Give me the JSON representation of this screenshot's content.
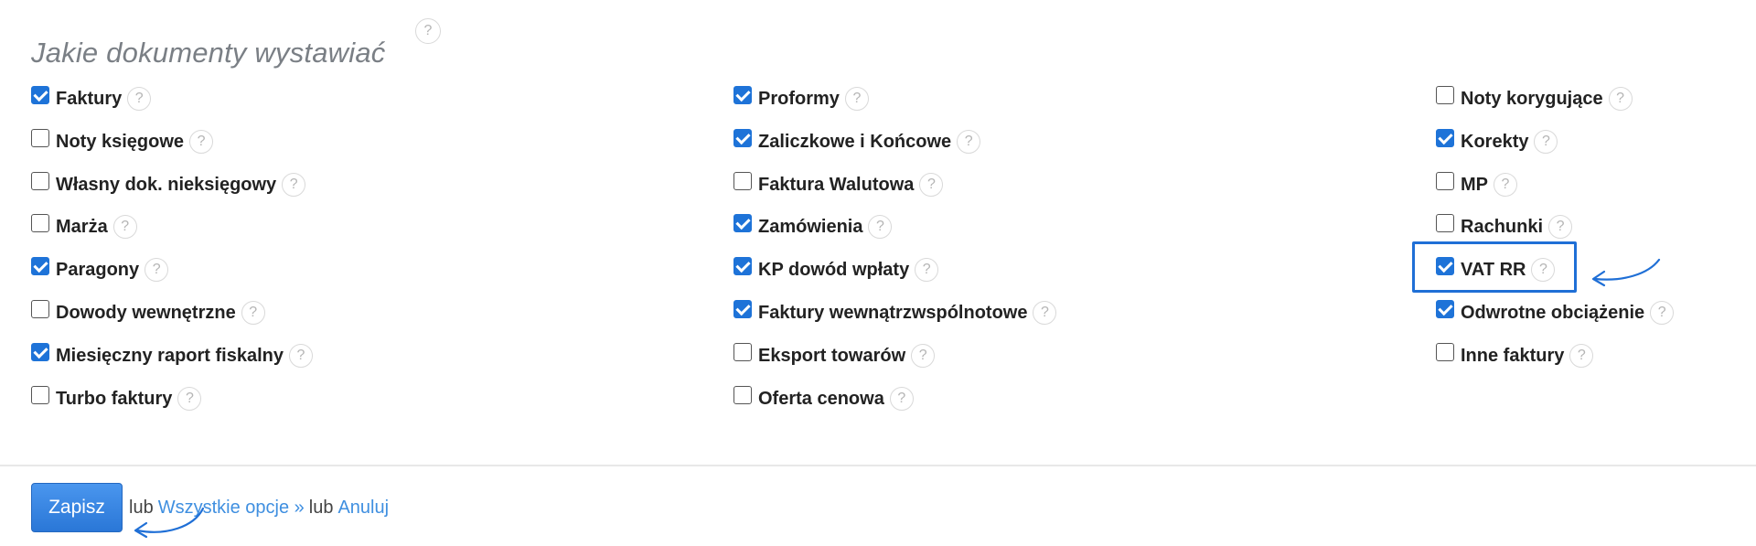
{
  "header": {
    "title": "Jakie dokumenty wystawiać",
    "help_glyph": "?"
  },
  "columns": [
    {
      "items": [
        {
          "label": "Faktury",
          "checked": true
        },
        {
          "label": "Noty księgowe",
          "checked": false
        },
        {
          "label": "Własny dok. nieksięgowy",
          "checked": false
        },
        {
          "label": "Marża",
          "checked": false
        },
        {
          "label": "Paragony",
          "checked": true
        },
        {
          "label": "Dowody wewnętrzne",
          "checked": false
        },
        {
          "label": "Miesięczny raport fiskalny",
          "checked": true
        },
        {
          "label": "Turbo faktury",
          "checked": false
        }
      ]
    },
    {
      "items": [
        {
          "label": "Proformy",
          "checked": true
        },
        {
          "label": "Zaliczkowe i Końcowe",
          "checked": true
        },
        {
          "label": "Faktura Walutowa",
          "checked": false
        },
        {
          "label": "Zamówienia",
          "checked": true
        },
        {
          "label": "KP dowód wpłaty",
          "checked": true
        },
        {
          "label": "Faktury wewnątrzwspólnotowe",
          "checked": true
        },
        {
          "label": "Eksport towarów",
          "checked": false
        },
        {
          "label": "Oferta cenowa",
          "checked": false
        }
      ]
    },
    {
      "items": [
        {
          "label": "Noty korygujące",
          "checked": false
        },
        {
          "label": "Korekty",
          "checked": true
        },
        {
          "label": "MP",
          "checked": false
        },
        {
          "label": "Rachunki",
          "checked": false
        },
        {
          "label": "VAT RR",
          "checked": true,
          "highlighted": true
        },
        {
          "label": "Odwrotne obciążenie",
          "checked": true
        },
        {
          "label": "Inne faktury",
          "checked": false
        }
      ]
    }
  ],
  "footer": {
    "save_label": "Zapisz",
    "or_1": "lub",
    "all_options_label": "Wszystkie opcje »",
    "or_2": "lub",
    "cancel_label": "Anuluj"
  },
  "colors": {
    "accent": "#1e73d8",
    "highlight_box": "#1f6fd6",
    "link": "#3f8fe0",
    "title": "#7a7f85"
  }
}
